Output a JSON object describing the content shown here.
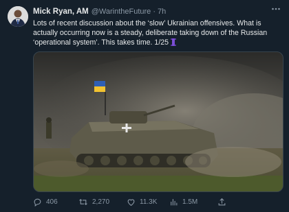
{
  "tweet": {
    "author_name": "Mick Ryan, AM",
    "handle": "@WarintheFuture",
    "separator": "·",
    "time": "7h",
    "text": "Lots of recent discussion about the ‘slow’ Ukrainian offensives.  What is actually occurring now is a steady, deliberate taking down of the Russian ‘operational system’. This takes time. 1/25",
    "more_icon": "ellipsis-icon",
    "media_icon": "armored-vehicle-photo"
  },
  "actions": {
    "replies": "406",
    "retweets": "2,270",
    "likes": "11.3K",
    "views": "1.5M"
  },
  "colors": {
    "background": "#15202b",
    "text": "#e7e9ea",
    "muted": "#8b98a5"
  }
}
